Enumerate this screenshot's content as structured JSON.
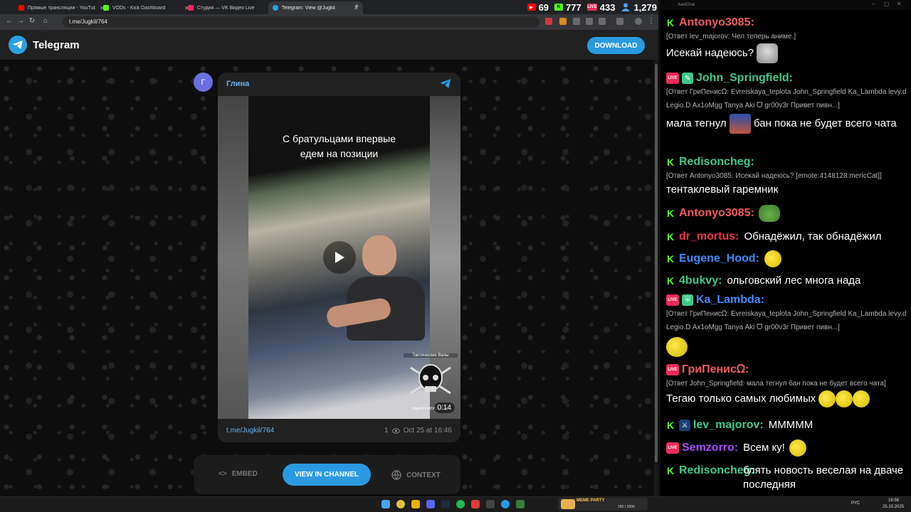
{
  "browser": {
    "tabs": [
      {
        "title": "Прямые трансляции - YouTube",
        "color": "#ff0000"
      },
      {
        "title": "VODs - Kick Dashboard",
        "color": "#53fc18"
      },
      {
        "title": "Студия — VK Видео Live",
        "color": "#f02a5a"
      },
      {
        "title": "Telegram: View @Jugkil",
        "color": "#2aa1e0"
      }
    ],
    "url": "t.me/Jugkil/764",
    "stats": [
      {
        "icon": "youtube-icon",
        "value": "69",
        "color": "#ff0000"
      },
      {
        "icon": "kick-icon",
        "value": "777",
        "color": "#53fc18"
      },
      {
        "icon": "vk-live-icon",
        "value": "433",
        "color": "#f02a5a"
      },
      {
        "icon": "viewers-icon",
        "value": "1,279",
        "color": "#4aa3ff"
      }
    ]
  },
  "telegram": {
    "brand": "Telegram",
    "download_label": "DOWNLOAD",
    "post": {
      "avatar_letter": "Г",
      "author": "Глина",
      "caption_line1": "С братульцами впервые",
      "caption_line2": "едем на позиции",
      "watermark_top": "Тактические Валы",
      "watermark_url": "https://t.me/DPG_Kovyl",
      "duration": "0:14",
      "link": "t.me/Jugkil/764",
      "views": "1",
      "date": "Oct 25 at 16:46"
    },
    "actions": {
      "embed": "EMBED",
      "view_in_channel": "VIEW IN CHANNEL",
      "context": "CONTEXT"
    }
  },
  "chat": {
    "app_title": "AxelChat",
    "messages": [
      {
        "platform": "kick",
        "badge": "",
        "user": "Antonyo3085:",
        "color": "#f25c5c",
        "reply": "[Ответ lev_majorov: Чел теперь аниме.]",
        "text": "Исекай надеюсь?",
        "emote": "cat"
      },
      {
        "platform": "vk",
        "badge": "pencil",
        "user": "John_Springfield:",
        "color": "#3ec98b",
        "reply": "[Ответ ГриПенисᘯ: Evreiskaya_teplota John_Springfield Ka_Lambda levy.d Legio.D Ax1oMgg Tanya Aki ᗜ gr00v3r Привет пивн...]",
        "text1": "мала тегнул",
        "text2": "бан пока не будет всего чата"
      },
      {
        "platform": "kick",
        "badge": "",
        "user": "Redisoncheg:",
        "color": "#3ec98b",
        "reply": "[Ответ Antonyo3085: Исекай надеюсь? [emote:4148128:mericCat]]",
        "text": "тентаклевый гаремник"
      },
      {
        "platform": "kick",
        "badge": "",
        "user": "Antonyo3085:",
        "color": "#f25c5c"
      },
      {
        "platform": "kick",
        "badge": "",
        "user": "dr_mortus:",
        "color": "#f2344a",
        "text": "Обнадёжил, так обнадёжил"
      },
      {
        "platform": "kick",
        "badge": "",
        "user": "Eugene_Hood:",
        "color": "#3f8cff"
      },
      {
        "platform": "kick",
        "badge": "",
        "user": "4bukvy:",
        "color": "#3ec98b",
        "text": "ольговский лес многа нада"
      },
      {
        "platform": "vk",
        "badge": "shield",
        "user": "Ka_Lambda:",
        "color": "#3f8cff",
        "reply": "[Ответ ГриПенисᘯ: Evreiskaya_teplota John_Springfield Ka_Lambda levy.d Legio.D Ax1oMgg Tanya Aki ᗜ gr00v3r Привет пивн...]"
      },
      {
        "platform": "vk",
        "badge": "",
        "user": "ГриПенисᘯ:",
        "color": "#f25c5c",
        "reply": "[Ответ John_Springfield: мала тегнул бан пока не будет всего чата]",
        "text": "Тегаю только самых любимых"
      },
      {
        "platform": "kick",
        "badge": "sword",
        "user": "lev_majorov:",
        "color": "#3ec98b",
        "text": "МММММ"
      },
      {
        "platform": "vk",
        "badge": "",
        "user": "Semzorro:",
        "color": "#a94dff",
        "text": "Всем ку!"
      },
      {
        "platform": "kick",
        "badge": "",
        "user": "Redisoncheg:",
        "color": "#3ec98b",
        "text": "блять новость веселая на дваче последняя"
      }
    ]
  },
  "taskbar": {
    "lang": "РУС",
    "time": "16:58",
    "date": "25.10.2025",
    "widget": "MEME PARTY",
    "widget_progress": "150 / 1500"
  }
}
